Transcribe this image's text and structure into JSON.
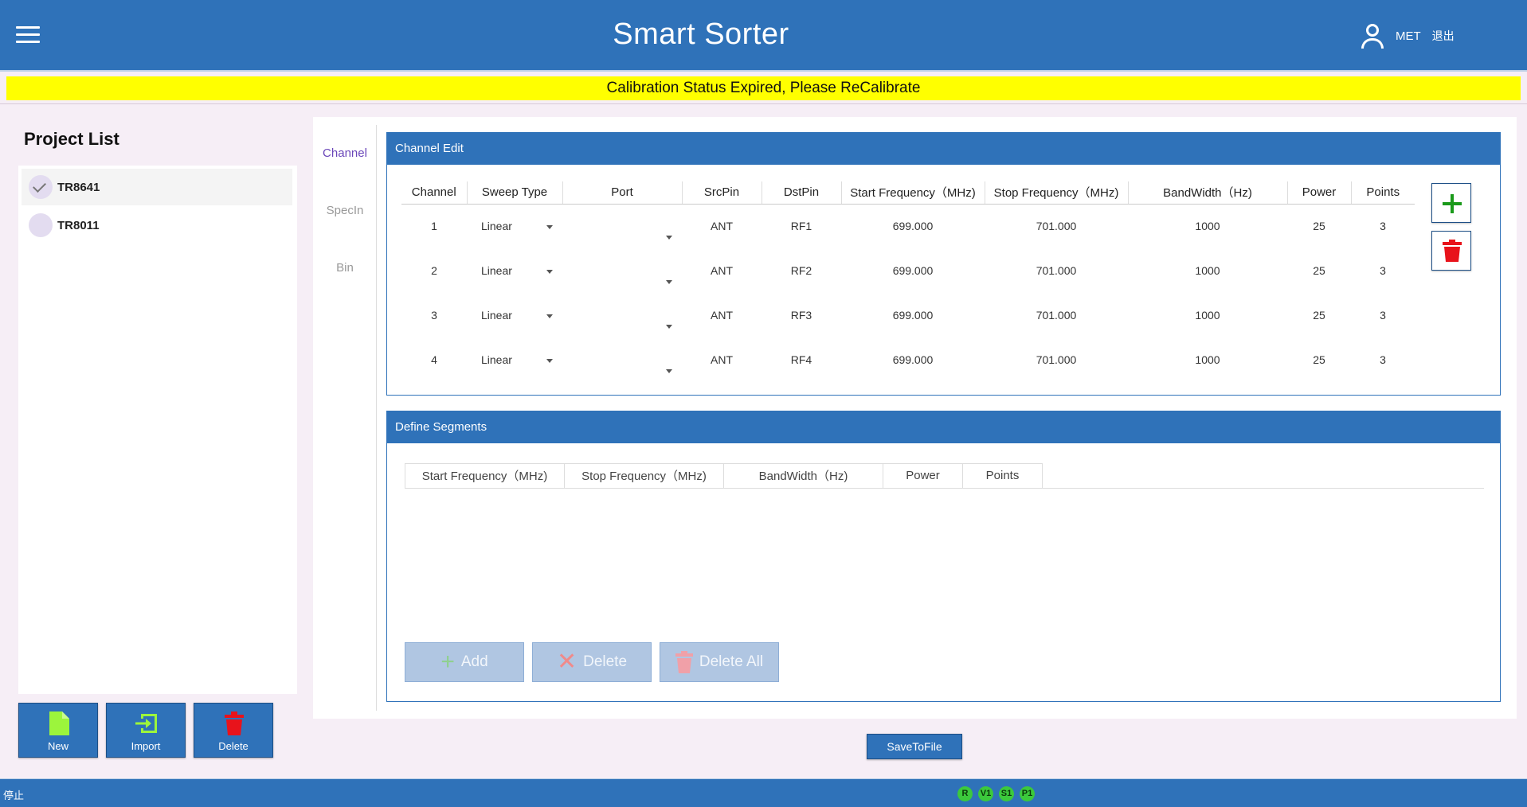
{
  "header": {
    "title": "Smart Sorter",
    "user": "MET",
    "logout_label": "退出"
  },
  "banner": {
    "message": "Calibration Status Expired, Please ReCalibrate"
  },
  "projects": {
    "title": "Project List",
    "items": [
      {
        "name": "TR8641",
        "selected": true
      },
      {
        "name": "TR8011",
        "selected": false
      }
    ],
    "buttons": {
      "new": "New",
      "import": "Import",
      "delete": "Delete"
    }
  },
  "tabs": {
    "channel": "Channel",
    "specin": "SpecIn",
    "bin": "Bin"
  },
  "channel_edit": {
    "title": "Channel Edit",
    "columns": [
      "Channel",
      "Sweep Type",
      "Port",
      "SrcPin",
      "DstPin",
      "Start Frequency（MHz)",
      "Stop Frequency（MHz)",
      "BandWidth（Hz)",
      "Power",
      "Points"
    ],
    "rows": [
      {
        "channel": "1",
        "sweep": "Linear",
        "port": "",
        "src": "ANT",
        "dst": "RF1",
        "start": "699.000",
        "stop": "701.000",
        "bw": "1000",
        "power": "25",
        "points": "3"
      },
      {
        "channel": "2",
        "sweep": "Linear",
        "port": "",
        "src": "ANT",
        "dst": "RF2",
        "start": "699.000",
        "stop": "701.000",
        "bw": "1000",
        "power": "25",
        "points": "3"
      },
      {
        "channel": "3",
        "sweep": "Linear",
        "port": "",
        "src": "ANT",
        "dst": "RF3",
        "start": "699.000",
        "stop": "701.000",
        "bw": "1000",
        "power": "25",
        "points": "3"
      },
      {
        "channel": "4",
        "sweep": "Linear",
        "port": "",
        "src": "ANT",
        "dst": "RF4",
        "start": "699.000",
        "stop": "701.000",
        "bw": "1000",
        "power": "25",
        "points": "3"
      }
    ]
  },
  "segments": {
    "title": "Define Segments",
    "columns": [
      "Start Frequency（MHz)",
      "Stop Frequency（MHz)",
      "BandWidth（Hz)",
      "Power",
      "Points"
    ],
    "buttons": {
      "add": "Add",
      "delete": "Delete",
      "delete_all": "Delete All"
    }
  },
  "save_label": "SaveToFile",
  "status": {
    "text": "停止",
    "indicators": [
      "R",
      "V1",
      "S1",
      "P1"
    ]
  },
  "colors": {
    "primary": "#2f72b9",
    "banner": "#ffff00",
    "add_green": "#1a9a1a",
    "delete_red": "#e8131b",
    "led_green": "#3cc93c"
  }
}
